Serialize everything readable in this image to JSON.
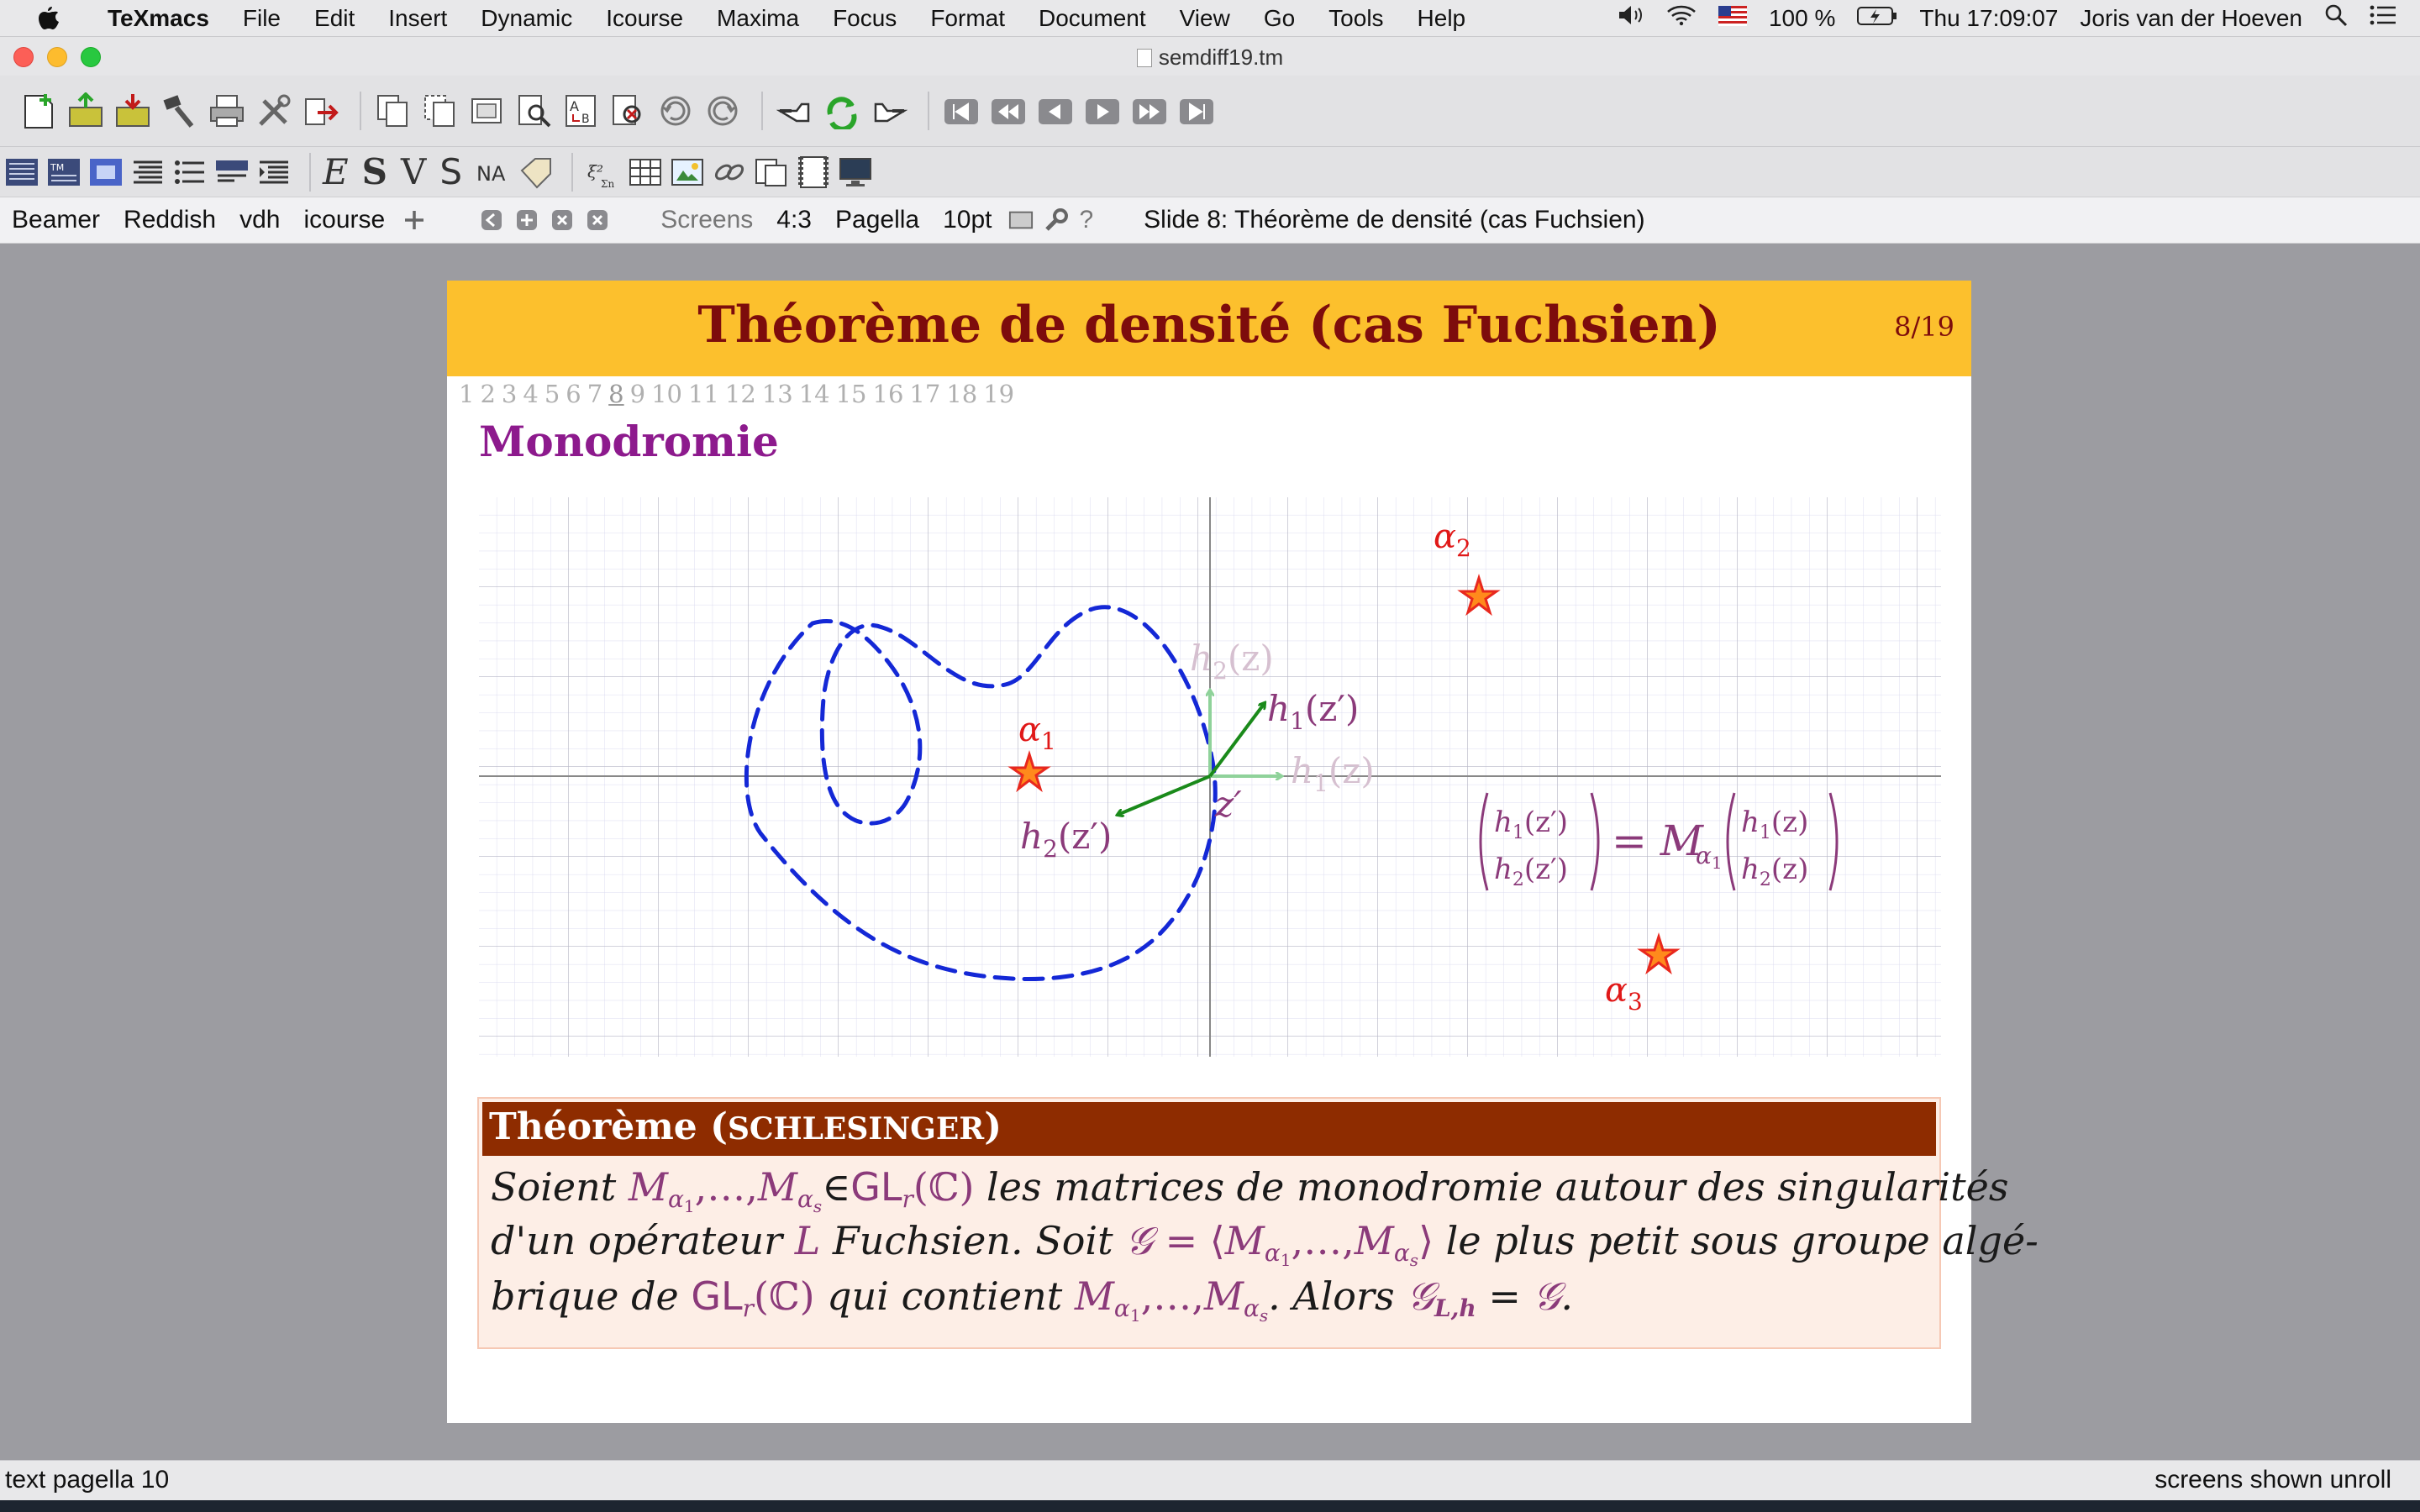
{
  "menubar": {
    "app_name": "TeXmacs",
    "menus": [
      "File",
      "Edit",
      "Insert",
      "Dynamic",
      "Icourse",
      "Maxima",
      "Focus",
      "Format",
      "Document",
      "View",
      "Go",
      "Tools",
      "Help"
    ],
    "battery": "100 %",
    "clock": "Thu 17:09:07",
    "user": "Joris van der Hoeven"
  },
  "window": {
    "title": "semdiff19.tm"
  },
  "modebar": {
    "style_packages": [
      "Beamer",
      "Reddish",
      "vdh",
      "icourse"
    ],
    "screens_label": "Screens",
    "ratio": "4:3",
    "font": "Pagella",
    "font_size": "10pt",
    "help": "?",
    "slide_info": "Slide 8: Théorème de densité (cas Fuchsien)"
  },
  "slide": {
    "title": "Théorème de densité (cas Fuchsien)",
    "number": "8/19",
    "nav_pages": [
      "1",
      "2",
      "3",
      "4",
      "5",
      "6",
      "7",
      "8",
      "9",
      "10",
      "11",
      "12",
      "13",
      "14",
      "15",
      "16",
      "17",
      "18",
      "19"
    ],
    "current_page": "8",
    "section": "Monodromie",
    "figure": {
      "labels": {
        "alpha1": "α",
        "alpha1_sub": "1",
        "alpha2": "α",
        "alpha2_sub": "2",
        "alpha3": "α",
        "alpha3_sub": "3",
        "z_prime": "z′",
        "h1z": "h",
        "h1z_arg": "(z)",
        "h2z_arg": "(z)",
        "h1zp_arg": "(z′)",
        "h2zp_arg": "(z′)",
        "equation_eq": "= M",
        "sub1": "1",
        "sub2": "2"
      },
      "colors": {
        "curve": "#1428d6",
        "vectors": "#1a8a1a",
        "faded_vectors": "#8fd29a",
        "stars": "#e8281e",
        "star_fill": "#ff8a1c",
        "labels": "#8b3a7a",
        "alpha_labels": "#e01818"
      }
    },
    "theorem": {
      "heading": "Théorème (",
      "heading_sc": "Schlesinger",
      "heading_end": ")",
      "line1_a": "Soient ",
      "line1_M": "M",
      "line1_alpha": "α",
      "line1_one": "1",
      "line1_dots": ",…,",
      "line1_s": "s",
      "line1_in": "∈",
      "line1_GL": "GL",
      "line1_r": "r",
      "line1_C": "(ℂ)",
      "line1_b": " les matrices de monodromie autour des singularités",
      "line2_a": "d'un opérateur ",
      "line2_L": "L",
      "line2_b": " Fuchsien. Soit ",
      "line2_G": "𝒢",
      "line2_eq": " = ⟨",
      "line2_close": "⟩",
      "line2_c": " le plus petit sous groupe algé-",
      "line3_a": "brique de ",
      "line3_b": " qui contient ",
      "line3_c": ". Alors ",
      "line3_GLh": "L,h",
      "line3_eq": " = ",
      "line3_end": "."
    }
  },
  "statusbar": {
    "left": "text pagella 10",
    "right": "screens shown unroll"
  }
}
